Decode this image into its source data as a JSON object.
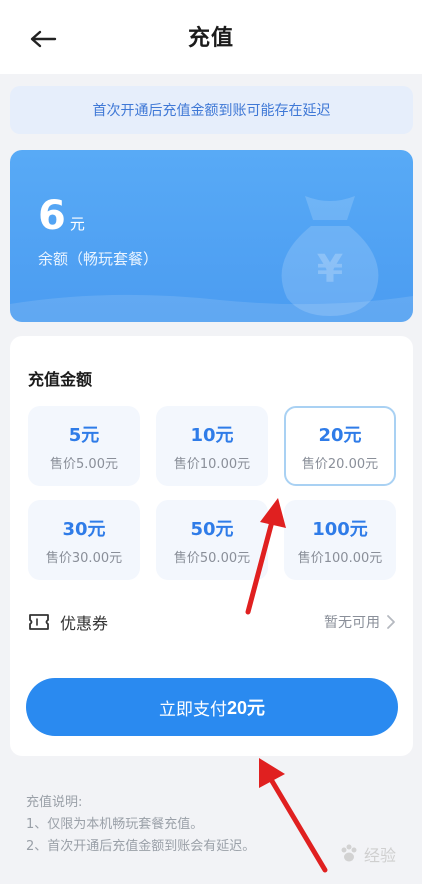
{
  "header": {
    "title": "充值"
  },
  "notice": {
    "text": "首次开通后充值金额到账可能存在延迟"
  },
  "balance": {
    "amount": "6",
    "unit": "元",
    "label": "余额（畅玩套餐）"
  },
  "recharge": {
    "section_title": "充值金额",
    "options": [
      {
        "amount": "5元",
        "price": "售价5.00元",
        "selected": false
      },
      {
        "amount": "10元",
        "price": "售价10.00元",
        "selected": false
      },
      {
        "amount": "20元",
        "price": "售价20.00元",
        "selected": true
      },
      {
        "amount": "30元",
        "price": "售价30.00元",
        "selected": false
      },
      {
        "amount": "50元",
        "price": "售价50.00元",
        "selected": false
      },
      {
        "amount": "100元",
        "price": "售价100.00元",
        "selected": false
      }
    ],
    "coupon_label": "优惠券",
    "coupon_status": "暂无可用",
    "pay_prefix": "立即支付",
    "pay_amount": "20元"
  },
  "notes": {
    "title": "充值说明:",
    "lines": [
      "1、仅限为本机畅玩套餐充值。",
      "2、首次开通后充值金额到账会有延迟。"
    ]
  },
  "watermark": {
    "text": "经验"
  },
  "colors": {
    "accent": "#2a8af0",
    "arrow": "#e02020"
  }
}
